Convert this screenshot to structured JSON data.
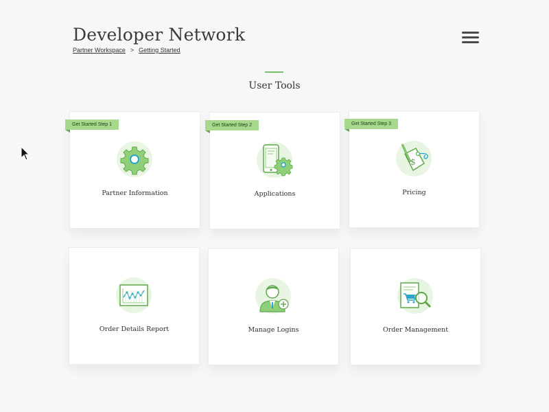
{
  "header": {
    "title": "Developer Network",
    "breadcrumb": [
      {
        "label": "Partner Workspace"
      },
      {
        "label": "Getting Started"
      }
    ],
    "breadcrumb_separator": ">"
  },
  "section": {
    "title": "User Tools"
  },
  "colors": {
    "accent": "#7ac06a",
    "badge": "#a6d98b",
    "icon_bg": "#e8f5e2"
  },
  "cards": [
    {
      "label": "Partner Information",
      "badge": "Get Started Step 1",
      "icon": "gear-icon"
    },
    {
      "label": "Applications",
      "badge": "Get Started Step 2",
      "icon": "mobile-gear-icon"
    },
    {
      "label": "Pricing",
      "badge": "Get Started Step 3",
      "icon": "price-tag-icon"
    },
    {
      "label": "Order Details Report",
      "icon": "chart-report-icon"
    },
    {
      "label": "Manage Logins",
      "icon": "user-add-icon"
    },
    {
      "label": "Order Management",
      "icon": "cart-search-icon"
    }
  ]
}
